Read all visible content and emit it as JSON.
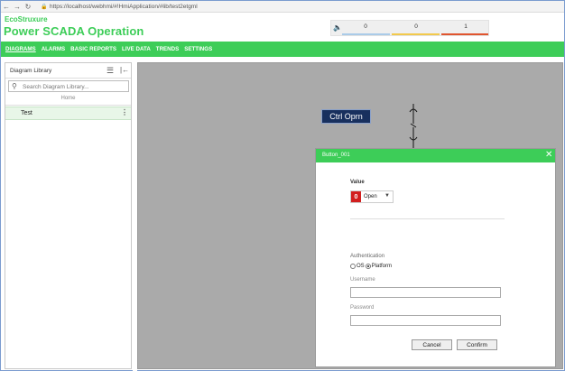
{
  "browser": {
    "back": "←",
    "forward": "→",
    "reload": "↻",
    "url": "https://localhost/webhmi/#!HmiApplication/#lib/test2etgml"
  },
  "header": {
    "brand_top": "EcoStruxure",
    "brand_main": "Power SCADA Operation",
    "alarms": [
      {
        "count": "0",
        "color": "#aacbe8"
      },
      {
        "count": "0",
        "color": "#f2c94c"
      },
      {
        "count": "1",
        "color": "#e0552f"
      }
    ]
  },
  "menu": {
    "items": [
      "DIAGRAMS",
      "ALARMS",
      "BASIC REPORTS",
      "LIVE DATA",
      "TRENDS",
      "SETTINGS"
    ]
  },
  "sidebar": {
    "title": "Diagram Library",
    "search_placeholder": "Search Diagram Library...",
    "home_label": "Home",
    "items": [
      {
        "label": "Test"
      }
    ]
  },
  "canvas": {
    "ctrl_button_label": "Ctrl Oprn"
  },
  "dialog": {
    "title": "Button_001",
    "value_label": "Value",
    "value_badge": "0",
    "value_text": "Open",
    "authentication_label": "Authentication",
    "radio_os": "OS",
    "radio_platform": "Platform",
    "username_label": "Username",
    "password_label": "Password",
    "cancel_label": "Cancel",
    "confirm_label": "Confirm"
  }
}
